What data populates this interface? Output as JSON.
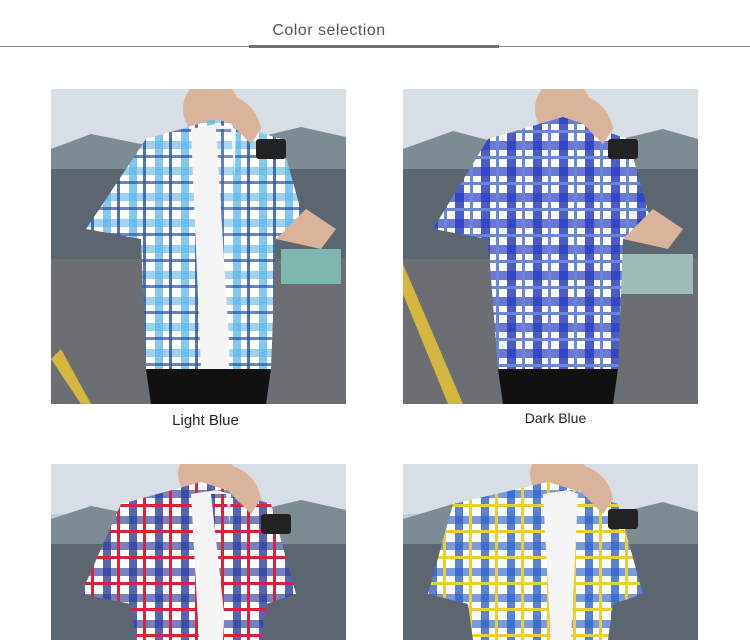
{
  "header": {
    "title": "Color selection"
  },
  "products": [
    {
      "name": "Light Blue",
      "shirt_colors": [
        "#5bb5e8",
        "#2c4fa8",
        "#ffffff"
      ],
      "image": "light-blue-shirt-photo"
    },
    {
      "name": "Dark Blue",
      "shirt_colors": [
        "#2b3fbf",
        "#6a86d8",
        "#ffffff"
      ],
      "image": "dark-blue-shirt-photo"
    },
    {
      "name": "",
      "shirt_colors": [
        "#d8233c",
        "#2d3f9e",
        "#ffffff"
      ],
      "image": "red-blue-shirt-photo"
    },
    {
      "name": "",
      "shirt_colors": [
        "#2f63c9",
        "#e8cf3a",
        "#ffffff"
      ],
      "image": "yellow-blue-shirt-photo"
    }
  ]
}
